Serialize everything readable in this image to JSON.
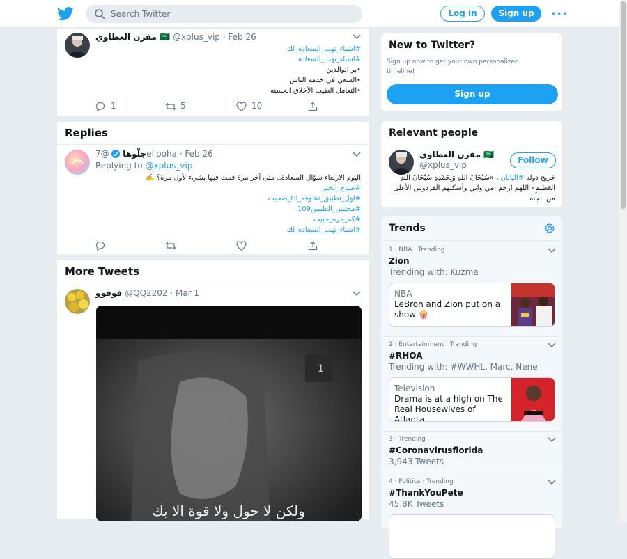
{
  "topbar": {
    "search_placeholder": "Search Twitter",
    "login_label": "Log in",
    "signup_label": "Sign up",
    "more_label": "•••"
  },
  "tweet1": {
    "name": "مقرن العطاوي 🇸🇦",
    "handle": "@xplus_vip",
    "date": "Feb 26",
    "lines": [
      "#اشياء_تهب_السعاده_لك",
      "#اشياء_تهب_السعاده",
      "•بر الوالدين",
      "•السعي في خدمة الناس",
      "•التعامل الطيب الأخلاق الحسنه"
    ],
    "replies": "1",
    "retweets": "5",
    "likes": "10"
  },
  "replies_section": {
    "title": "Replies"
  },
  "tweet2": {
    "name": "جلّوها",
    "handle": "@7ellooha",
    "date": "Feb 26",
    "replying_prefix": "Replying to",
    "replying_to": "@xplus_vip",
    "lines": [
      "اليوم الاربعاء سؤال السعادة.. متى آخر مرة قمت فيها بشيء لأول مرة؟ ✍️",
      "#صباح_الخير",
      "#اول_تطبيق_تشوفه_اذا_صحيت",
      "#مجلس_الطيبين109",
      "#كم_مره_حبيت",
      "#اشياء_تهب_السعاده_لك"
    ]
  },
  "more_section": {
    "title": "More Tweets"
  },
  "tweet3": {
    "name": "فوفوو",
    "handle": "@QQ2202",
    "date": "Mar 1",
    "video_caption": "ولكن لا حول ولا قوة الا بك"
  },
  "new_to_twitter": {
    "title": "New to Twitter?",
    "text": "Sign up now to get your own personalized timeline!",
    "button": "Sign up"
  },
  "relevant": {
    "title": "Relevant people",
    "name": "مقرن العطاوي 🇸🇦",
    "handle": "@xplus_vip",
    "follow": "Follow",
    "bio_1": "خريج دوله",
    "bio_link": "#اليابان",
    "bio_2": "، «سُبْحَانَ اللهِ وَبِحَمْدِهِ سُبْحَانَ اللهِ العَظِيمِ» اللهم ارحم امي وابي وأسكنهم الفردوس الأعلى من الجنه"
  },
  "trends": {
    "title": "Trends",
    "items": [
      {
        "meta": "1 · NBA · Trending",
        "name": "Zion",
        "sub": "Trending with: Kuzma",
        "news_cat": "NBA",
        "news_title": "LeBron and Zion put on a show 🍿"
      },
      {
        "meta": "2 · Entertainment · Trending",
        "name": "#RHOA",
        "sub": "Trending with: #WWHL, Marc, Nene",
        "news_cat": "Television",
        "news_title": "Drama is at a high on The Real Housewives of Atlanta"
      },
      {
        "meta": "3 · Trending",
        "name": "#Coronavirusflorida",
        "sub": "3,943 Tweets"
      },
      {
        "meta": "4 · Politics · Trending",
        "name": "#ThankYouPete",
        "sub": "45.8K Tweets"
      }
    ]
  },
  "colors": {
    "accent": "#1da1f2",
    "background": "#e6ecf0",
    "muted": "#657786"
  }
}
